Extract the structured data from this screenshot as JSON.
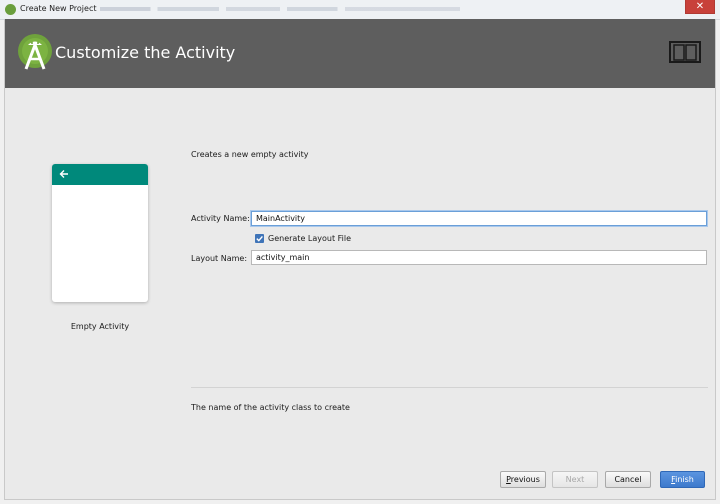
{
  "window": {
    "title": "Create New Project",
    "close_glyph": "✕"
  },
  "header": {
    "title": "Customize the Activity",
    "logo_icon": "android-studio-logo-icon",
    "device_icon": "device-preview-icon"
  },
  "preview": {
    "label": "Empty Activity",
    "toolbar_color": "#00897b"
  },
  "form": {
    "description": "Creates a new empty activity",
    "activity_name": {
      "label": "Activity Name:",
      "value": "MainActivity"
    },
    "generate_layout": {
      "label": "Generate Layout File",
      "checked": true
    },
    "layout_name": {
      "label": "Layout Name:",
      "value": "activity_main"
    }
  },
  "hint": "The name of the activity class to create",
  "buttons": {
    "previous_rest": "revious",
    "previous_mnemonic": "P",
    "next": "Next",
    "cancel": "Cancel",
    "finish_mnemonic": "F",
    "finish_rest": "inish"
  },
  "colors": {
    "accent": "#3d79cc",
    "header_bg": "#5e5e5e"
  }
}
